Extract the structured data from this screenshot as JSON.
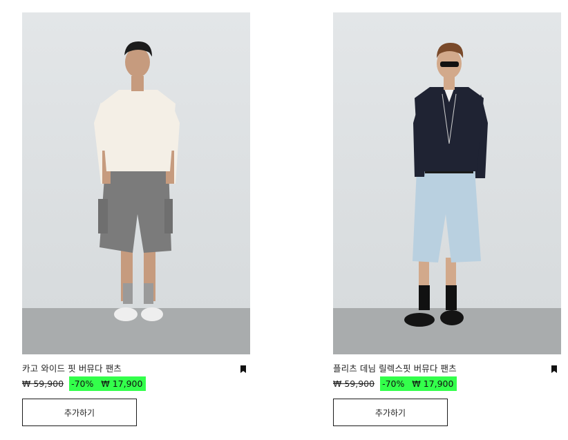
{
  "products": [
    {
      "name": "카고 와이드 핏 버뮤다 팬츠",
      "old_price": "₩ 59,900",
      "discount": "-70%",
      "sale_price": "₩ 17,900",
      "add_label": "추가하기"
    },
    {
      "name": "플리츠 데님 릴렉스핏 버뮤다 팬츠",
      "old_price": "₩ 59,900",
      "discount": "-70%",
      "sale_price": "₩ 17,900",
      "add_label": "추가하기"
    }
  ],
  "colors": {
    "sale_highlight": "#33ff4b",
    "photo_wall": "#dfe3e5",
    "photo_floor": "#a9acad"
  },
  "icons": {
    "bookmark": "bookmark-icon"
  }
}
